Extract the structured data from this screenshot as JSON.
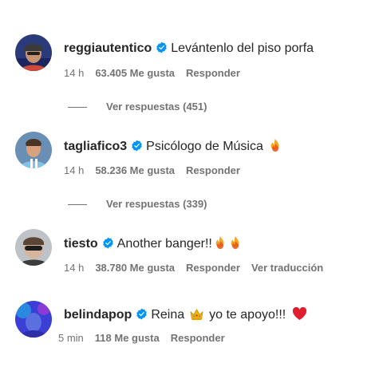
{
  "comments": [
    {
      "username": "reggiautentico",
      "text": "Levántenlo del piso porfa",
      "time": "14 h",
      "likes": "63.405 Me gusta",
      "reply_label": "Responder",
      "view_replies": "Ver respuestas (451)",
      "avatar_icon": "profile-photo-icon"
    },
    {
      "username": "tagliafico3",
      "text": "Psicólogo de Música",
      "emoji": "fire-emoji",
      "time": "14 h",
      "likes": "58.236 Me gusta",
      "reply_label": "Responder",
      "view_replies": "Ver respuestas (339)",
      "avatar_icon": "profile-photo-icon"
    },
    {
      "username": "tiesto",
      "text": "Another banger!!",
      "emoji": "fire-emoji x2",
      "time": "14 h",
      "likes": "38.780 Me gusta",
      "reply_label": "Responder",
      "translate_label": "Ver traducción",
      "avatar_icon": "profile-photo-icon"
    },
    {
      "username": "belindapop",
      "text_before": "Reina",
      "text_after": "yo te apoyo!!!",
      "emoji_mid": "crown-emoji",
      "emoji_end": "red-heart-emoji",
      "time": "5 min",
      "likes": "118 Me gusta",
      "reply_label": "Responder",
      "avatar_icon": "profile-photo-icon"
    }
  ],
  "colors": {
    "text": "#262626",
    "secondary": "#737373",
    "verified": "#0095f6"
  }
}
